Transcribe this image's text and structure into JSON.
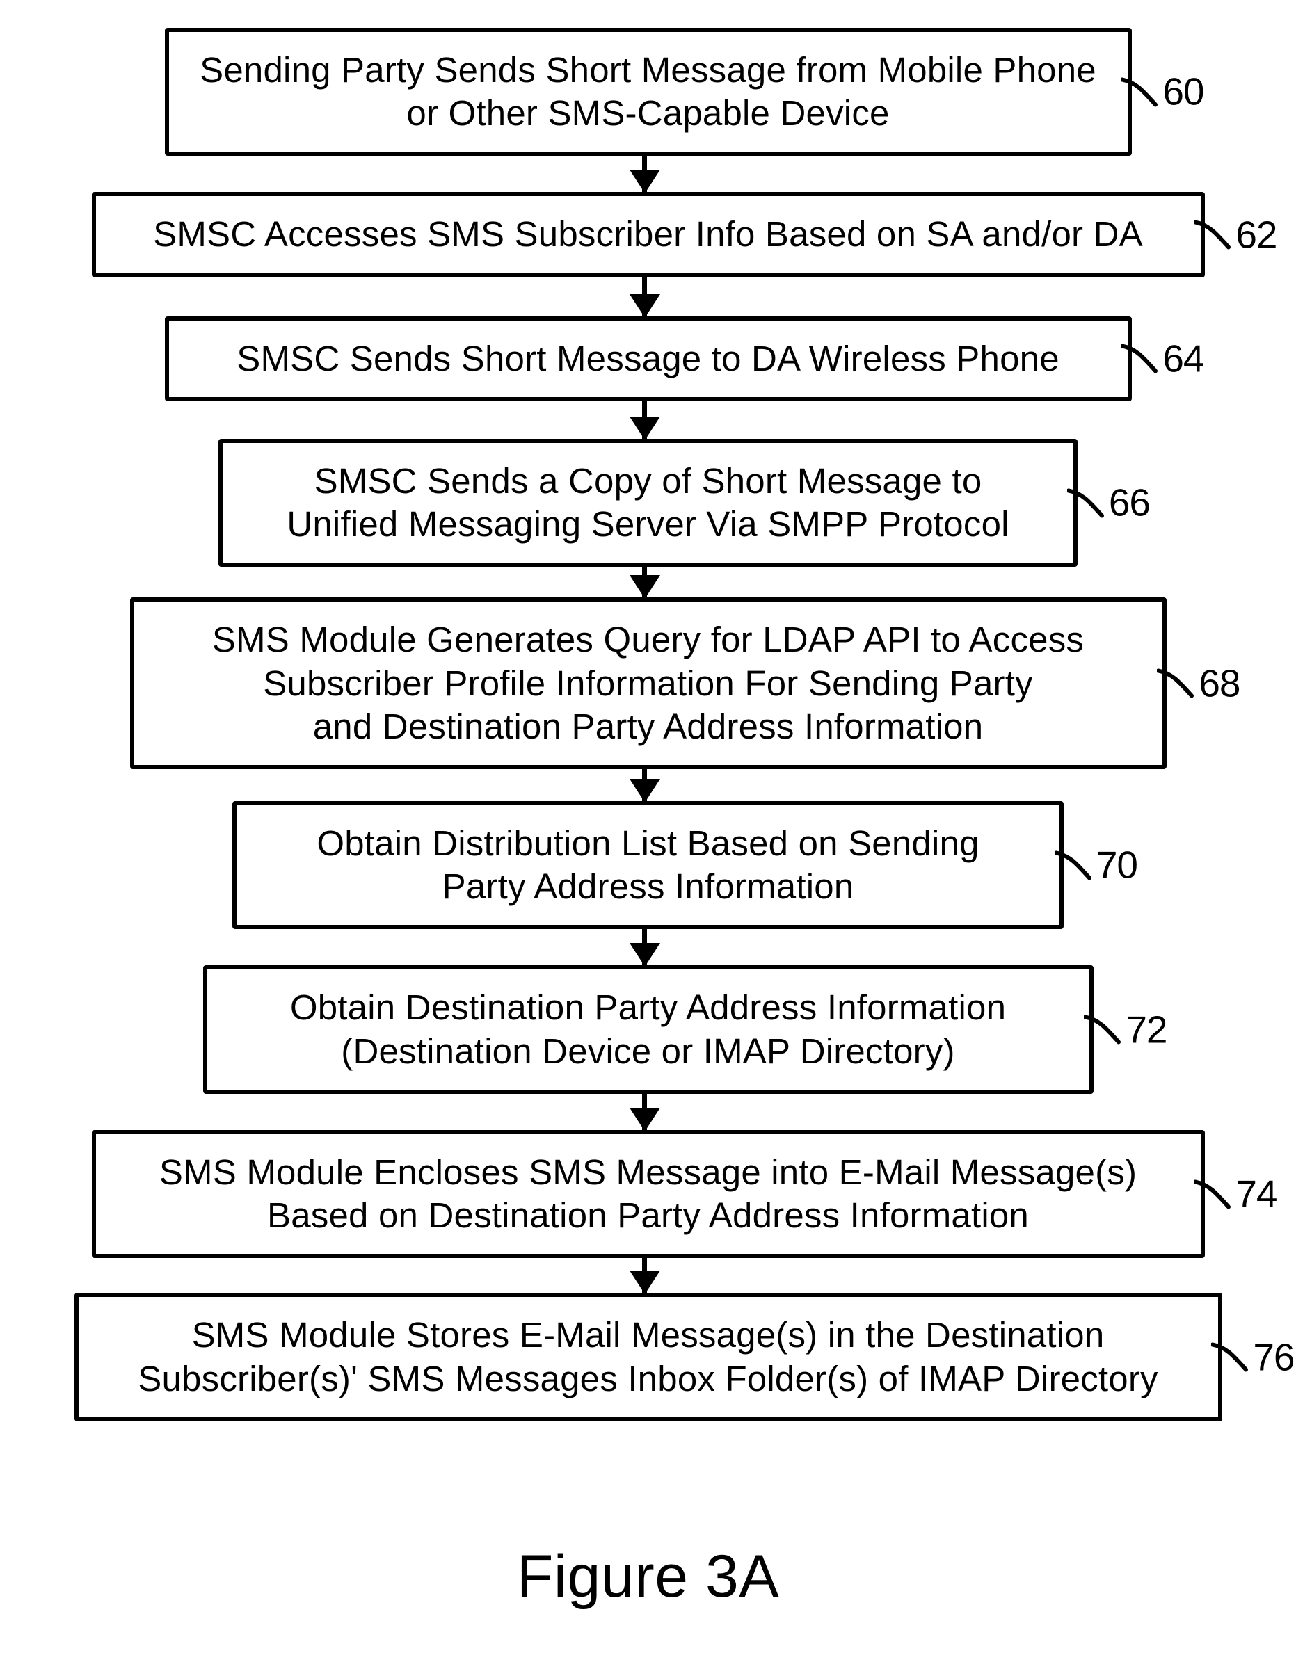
{
  "figure": {
    "caption": "Figure 3A",
    "steps": [
      {
        "ref": "60",
        "text": "Sending Party Sends Short Message from Mobile Phone\nor Other SMS-Capable Device"
      },
      {
        "ref": "62",
        "text": "SMSC Accesses SMS Subscriber Info Based on SA and/or DA"
      },
      {
        "ref": "64",
        "text": "SMSC Sends Short Message to DA Wireless Phone"
      },
      {
        "ref": "66",
        "text": "SMSC Sends a Copy of Short Message to\nUnified Messaging Server Via SMPP Protocol"
      },
      {
        "ref": "68",
        "text": "SMS Module Generates Query for LDAP API to Access\nSubscriber Profile Information For Sending Party\nand Destination Party Address Information"
      },
      {
        "ref": "70",
        "text": "Obtain Distribution List Based on Sending\nParty Address Information"
      },
      {
        "ref": "72",
        "text": "Obtain Destination Party Address Information\n(Destination Device or IMAP Directory)"
      },
      {
        "ref": "74",
        "text": "SMS Module Encloses SMS Message into E-Mail Message(s)\nBased on Destination Party Address Information"
      },
      {
        "ref": "76",
        "text": "SMS Module Stores E-Mail Message(s) in the Destination\nSubscriber(s)' SMS Messages Inbox Folder(s) of IMAP Directory"
      }
    ]
  },
  "layout": {
    "widths": [
      1390,
      1600,
      1390,
      1235,
      1490,
      1195,
      1280,
      1600,
      1650
    ],
    "arrowHeights": [
      52,
      56,
      54,
      44,
      46,
      52,
      52,
      50
    ],
    "refOffsets": [
      -110,
      -110,
      -110,
      -110,
      -112,
      -112,
      -112,
      -110,
      -110
    ]
  }
}
